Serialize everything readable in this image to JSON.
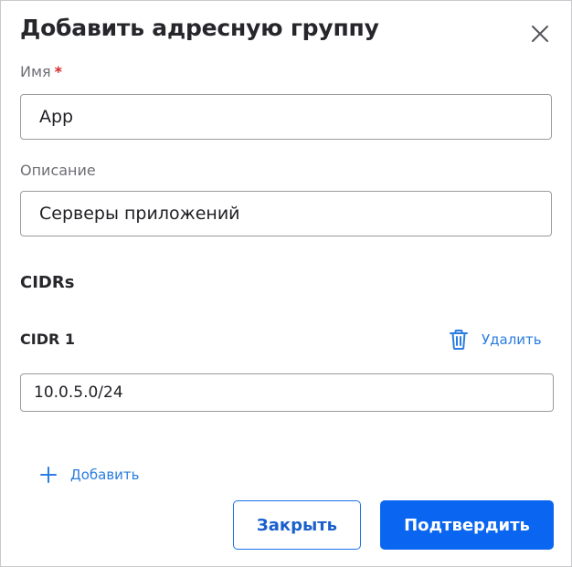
{
  "dialog": {
    "title": "Добавить адресную группу",
    "close_icon": "close-icon"
  },
  "name_field": {
    "label": "Имя",
    "required_mark": "*",
    "value": "App"
  },
  "description_field": {
    "label": "Описание",
    "value": "Серверы приложений"
  },
  "cidrs": {
    "section_title": "CIDRs",
    "items": [
      {
        "label": "CIDR 1",
        "value": "10.0.5.0/24",
        "delete_label": "Удалить",
        "delete_icon": "trash-icon"
      }
    ],
    "add_label": "Добавить",
    "add_icon": "plus-icon"
  },
  "footer": {
    "close_label": "Закрыть",
    "confirm_label": "Подтвердить"
  },
  "colors": {
    "accent": "#0a66f0",
    "link": "#2a7de1",
    "required": "#d6262b",
    "border": "#9b9ba0"
  }
}
